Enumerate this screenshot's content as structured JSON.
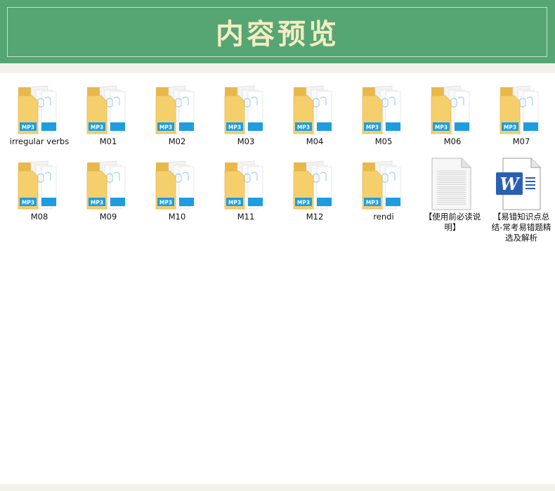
{
  "banner": {
    "title": "内容预览"
  },
  "icons": {
    "folder": "folder-mp3-icon",
    "text": "text-document-icon",
    "word": "word-document-icon"
  },
  "files": [
    {
      "name": "irregular verbs",
      "type": "folder"
    },
    {
      "name": "M01",
      "type": "folder"
    },
    {
      "name": "M02",
      "type": "folder"
    },
    {
      "name": "M03",
      "type": "folder"
    },
    {
      "name": "M04",
      "type": "folder"
    },
    {
      "name": "M05",
      "type": "folder"
    },
    {
      "name": "M06",
      "type": "folder"
    },
    {
      "name": "M07",
      "type": "folder"
    },
    {
      "name": "M08",
      "type": "folder"
    },
    {
      "name": "M09",
      "type": "folder"
    },
    {
      "name": "M10",
      "type": "folder"
    },
    {
      "name": "M11",
      "type": "folder"
    },
    {
      "name": "M12",
      "type": "folder"
    },
    {
      "name": "rendi",
      "type": "folder"
    },
    {
      "name": "【使用前必读说明】",
      "type": "text"
    },
    {
      "name": "【易错知识点总结-常考易错题精选及解析",
      "type": "word"
    }
  ],
  "colors": {
    "banner_bg": "#56a673",
    "title": "#f4ecc4",
    "folder": "#f5cf6b",
    "mp3_blue": "#1d9de0",
    "word_blue": "#2b5fb4"
  }
}
